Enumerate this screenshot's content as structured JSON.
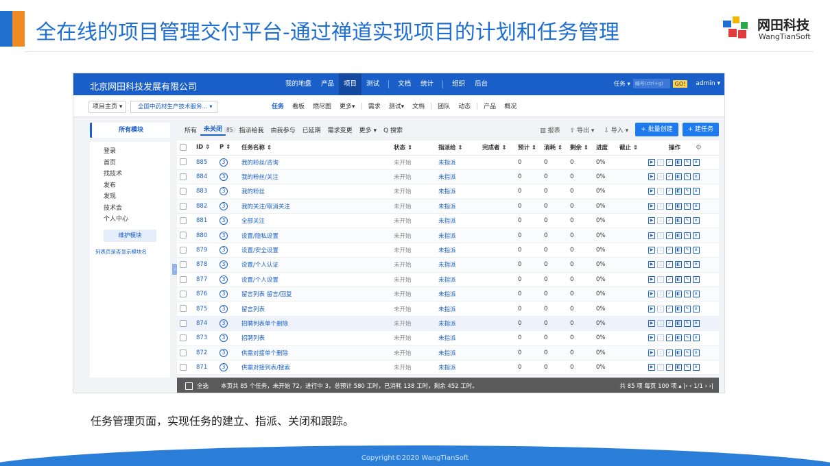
{
  "slide": {
    "title": "全在线的项目管理交付平台-通过禅道实现项目的计划和任务管理",
    "logo_cn": "网田科技",
    "logo_en": "WangTianSoft",
    "caption": "任务管理页面，实现任务的建立、指派、关闭和跟踪。",
    "copyright": "Copyright©2020 WangTianSoft"
  },
  "app": {
    "brand": "北京网田科技发展有限公司",
    "main_nav": [
      "我的地盘",
      "产品",
      "项目",
      "测试",
      "文档",
      "统计",
      "组织",
      "后台"
    ],
    "active_nav": "项目",
    "top_select": "任务 ▾",
    "search_placeholder": "编号(ctrl+g)",
    "go": "GO!",
    "user": "admin ▾",
    "crumb_home": "项目主页 ▾",
    "crumb_project": "全国中药材生产技术服务... ▾",
    "sub_nav": [
      "任务",
      "看板",
      "燃尽图",
      "更多▾",
      "需求",
      "测试▾",
      "文档",
      "团队",
      "动态",
      "产品",
      "概况"
    ],
    "active_sub": "任务"
  },
  "sidebar": {
    "title": "所有模块",
    "items": [
      "登录",
      "首页",
      "找技术",
      "发布",
      "发现",
      "技术会",
      "个人中心"
    ],
    "maintain_btn": "维护模块",
    "link": "列表页是否显示模块名",
    "toggle": "‹"
  },
  "filters": {
    "tabs": [
      "所有",
      "未关闭",
      "指派给我",
      "由我参与",
      "已延期",
      "需求变更",
      "更多 ▾"
    ],
    "active": "未关闭",
    "count": "85",
    "search": "Q 搜索"
  },
  "actions": {
    "report": "报表",
    "export": "导出 ▾",
    "import": "导入 ▾",
    "batch": "+ 批量创建",
    "create": "+ 建任务"
  },
  "table": {
    "headers": [
      "ID ⇕",
      "P ⇕",
      "任务名称 ⇕",
      "状态 ⇕",
      "指派给 ⇕",
      "完成者 ⇕",
      "预计 ⇕",
      "消耗 ⇕",
      "剩余 ⇕",
      "进度",
      "截止 ⇕",
      "操作"
    ],
    "rows": [
      {
        "id": "885",
        "p": "3",
        "name": "我的粉丝/咨询",
        "status": "未开始",
        "assignee": "未指派",
        "est": "0",
        "used": "0",
        "left": "0",
        "progress": "0%"
      },
      {
        "id": "884",
        "p": "3",
        "name": "我的粉丝/关注",
        "status": "未开始",
        "assignee": "未指派",
        "est": "0",
        "used": "0",
        "left": "0",
        "progress": "0%"
      },
      {
        "id": "883",
        "p": "3",
        "name": "我的粉丝",
        "status": "未开始",
        "assignee": "未指派",
        "est": "0",
        "used": "0",
        "left": "0",
        "progress": "0%"
      },
      {
        "id": "882",
        "p": "3",
        "name": "我的关注/取消关注",
        "status": "未开始",
        "assignee": "未指派",
        "est": "0",
        "used": "0",
        "left": "0",
        "progress": "0%"
      },
      {
        "id": "881",
        "p": "3",
        "name": "全部关注",
        "status": "未开始",
        "assignee": "未指派",
        "est": "0",
        "used": "0",
        "left": "0",
        "progress": "0%"
      },
      {
        "id": "880",
        "p": "3",
        "name": "设置/隐私设置",
        "status": "未开始",
        "assignee": "未指派",
        "est": "0",
        "used": "0",
        "left": "0",
        "progress": "0%"
      },
      {
        "id": "879",
        "p": "3",
        "name": "设置/安全设置",
        "status": "未开始",
        "assignee": "未指派",
        "est": "0",
        "used": "0",
        "left": "0",
        "progress": "0%"
      },
      {
        "id": "878",
        "p": "3",
        "name": "设置/个人认证",
        "status": "未开始",
        "assignee": "未指派",
        "est": "0",
        "used": "0",
        "left": "0",
        "progress": "0%"
      },
      {
        "id": "877",
        "p": "3",
        "name": "设置/个人设置",
        "status": "未开始",
        "assignee": "未指派",
        "est": "0",
        "used": "0",
        "left": "0",
        "progress": "0%"
      },
      {
        "id": "876",
        "p": "3",
        "name": "留言列表 留言/回复",
        "status": "未开始",
        "assignee": "未指派",
        "est": "0",
        "used": "0",
        "left": "0",
        "progress": "0%"
      },
      {
        "id": "875",
        "p": "3",
        "name": "留言列表",
        "status": "未开始",
        "assignee": "未指派",
        "est": "0",
        "used": "0",
        "left": "0",
        "progress": "0%"
      },
      {
        "id": "874",
        "p": "3",
        "name": "招聘列表单个删除",
        "status": "未开始",
        "assignee": "未指派",
        "est": "0",
        "used": "0",
        "left": "0",
        "progress": "0%"
      },
      {
        "id": "873",
        "p": "3",
        "name": "招聘列表",
        "status": "未开始",
        "assignee": "未指派",
        "est": "0",
        "used": "0",
        "left": "0",
        "progress": "0%"
      },
      {
        "id": "872",
        "p": "3",
        "name": "供需对接单个删除",
        "status": "未开始",
        "assignee": "未指派",
        "est": "0",
        "used": "0",
        "left": "0",
        "progress": "0%"
      },
      {
        "id": "871",
        "p": "3",
        "name": "供需对接列表/搜索",
        "status": "未开始",
        "assignee": "未指派",
        "est": "0",
        "used": "0",
        "left": "0",
        "progress": "0%"
      }
    ]
  },
  "footer": {
    "select_all": "全选",
    "summary": "本页共 85 个任务，未开始 72，进行中 3，总预计 580 工时，已消耗 138 工时，剩余 452 工时。",
    "pager": "共 85 项  每页 100 项 ▴  |‹  ‹  1/1  ›  ›|"
  },
  "colors": {
    "primary": "#1a5fc8",
    "accent": "#f08a24",
    "create": "#1e7bef"
  }
}
